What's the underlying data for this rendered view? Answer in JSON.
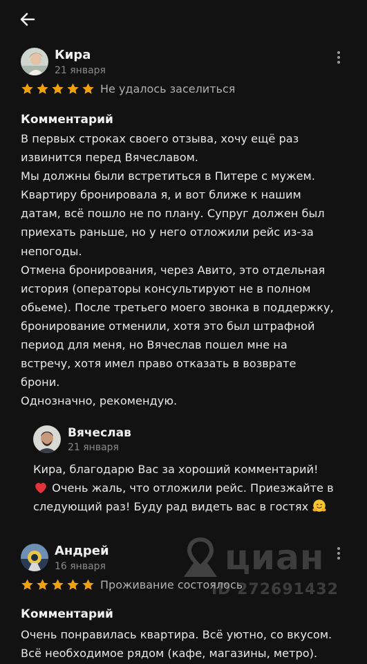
{
  "colors": {
    "background": "#121212",
    "star": "#f2a20d",
    "heart": "#e2333c",
    "secondary_text": "#8a8a8a"
  },
  "icons": {
    "back": "arrow-left-icon",
    "more": "more-vertical-icon",
    "star": "star-icon",
    "heart": "heart-emoji",
    "hug": "hugging-face-emoji"
  },
  "reviews": [
    {
      "author": "Кира",
      "date": "21 января",
      "stars": 5,
      "rating_text": "Не удалось заселиться",
      "comment_title": "Комментарий",
      "comment": "В первых строках своего отзыва, хочу ещё раз\nизвинится перед Вячеславом.\nМы должны были встретиться в Питере с мужем.\nКвартиру бронировала я, и вот ближе к нашим\nдатам, всё пошло не по плану. Супруг должен был\nприехать раньше, но у него отложили рейс из-за\nнепогоды.\nОтмена бронирования, через Авито, это отдельная\nистория (операторы консультируют не в полном\nобьеме). После третьего моего звонка в поддержку,\nбронирование отменили, хотя это был штрафной\nпериод для меня, но Вячеслав пошел мне на\nвстречу, хотя имел право отказать в возврате\nброни.\nОднозначно, рекомендую.",
      "reply": {
        "author": "Вячеслав",
        "date": "21 января",
        "text_1": "Кира, благодарю Вас за хороший комментарий!",
        "text_2": "Очень жаль, что отложили рейс. Приезжайте в",
        "text_3": "следующий раз! Буду рад видеть вас в гостях"
      }
    },
    {
      "author": "Андрей",
      "date": "16 января",
      "stars": 5,
      "rating_text": "Проживание состоялось",
      "comment_title": "Комментарий",
      "comment": "Очень понравилась квартира. Всё уютно, со вкусом.\nВсё необходимое рядом (кафе, магазины, метро)."
    }
  ],
  "watermark": {
    "brand": "циан",
    "id": "ID 272691432"
  }
}
